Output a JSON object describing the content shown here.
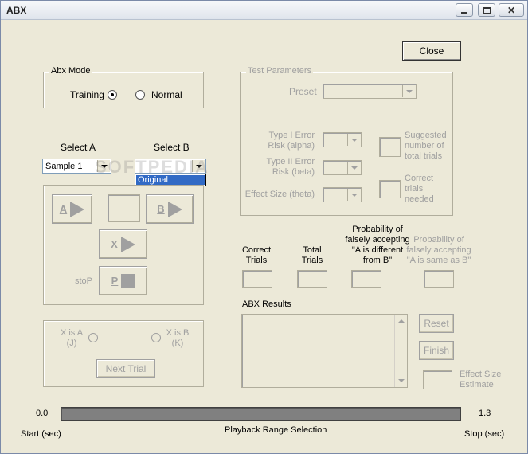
{
  "window": {
    "title": "ABX"
  },
  "close_button": "Close",
  "abx_mode": {
    "label": "Abx Mode",
    "training": "Training",
    "normal": "Normal",
    "selected": "Training"
  },
  "select_a": {
    "label": "Select A",
    "value": "Sample 1"
  },
  "select_b": {
    "label": "Select B",
    "value": "",
    "dropdown_options": [
      "Original"
    ],
    "highlighted": "Original"
  },
  "playback": {
    "a_label": "A",
    "b_label": "B",
    "x_label": "X",
    "p_label": "P",
    "stop_label": "stoP"
  },
  "x_choice": {
    "x_is_a": "X is A",
    "x_is_a_key": "(J)",
    "x_is_b": "X is B",
    "x_is_b_key": "(K)",
    "next_trial": "Next Trial"
  },
  "test_parameters": {
    "label": "Test Parameters",
    "preset": "Preset",
    "type1_line1": "Type I Error",
    "type1_line2": "Risk (alpha)",
    "type2_line1": "Type II Error",
    "type2_line2": "Risk (beta)",
    "effect_size": "Effect Size (theta)",
    "suggested_line1": "Suggested",
    "suggested_line2": "number of",
    "suggested_line3": "total trials",
    "correct_needed_line1": "Correct",
    "correct_needed_line2": "trials",
    "correct_needed_line3": "needed"
  },
  "stats": {
    "correct_line1": "Correct",
    "correct_line2": "Trials",
    "total_line1": "Total",
    "total_line2": "Trials",
    "prob_diff_line1": "Probability of",
    "prob_diff_line2": "falsely accepting",
    "prob_diff_line3": "\"A is different",
    "prob_diff_line4": "from B\"",
    "prob_same_line1": "Probability of",
    "prob_same_line2": "falsely accepting",
    "prob_same_line3": "\"A is same as B\""
  },
  "results": {
    "label": "ABX Results",
    "reset": "Reset",
    "finish": "Finish",
    "effect_line1": "Effect Size",
    "effect_line2": "Estimate"
  },
  "range": {
    "start_value": "0.0",
    "end_value": "1.3",
    "start_label": "Start (sec)",
    "stop_label": "Stop (sec)",
    "title": "Playback Range Selection"
  },
  "watermark": "SOFTPEDIA",
  "colors": {
    "highlight": "#316ac5",
    "disabled_text": "#a0a0a0",
    "window_bg": "#ece9d8"
  }
}
